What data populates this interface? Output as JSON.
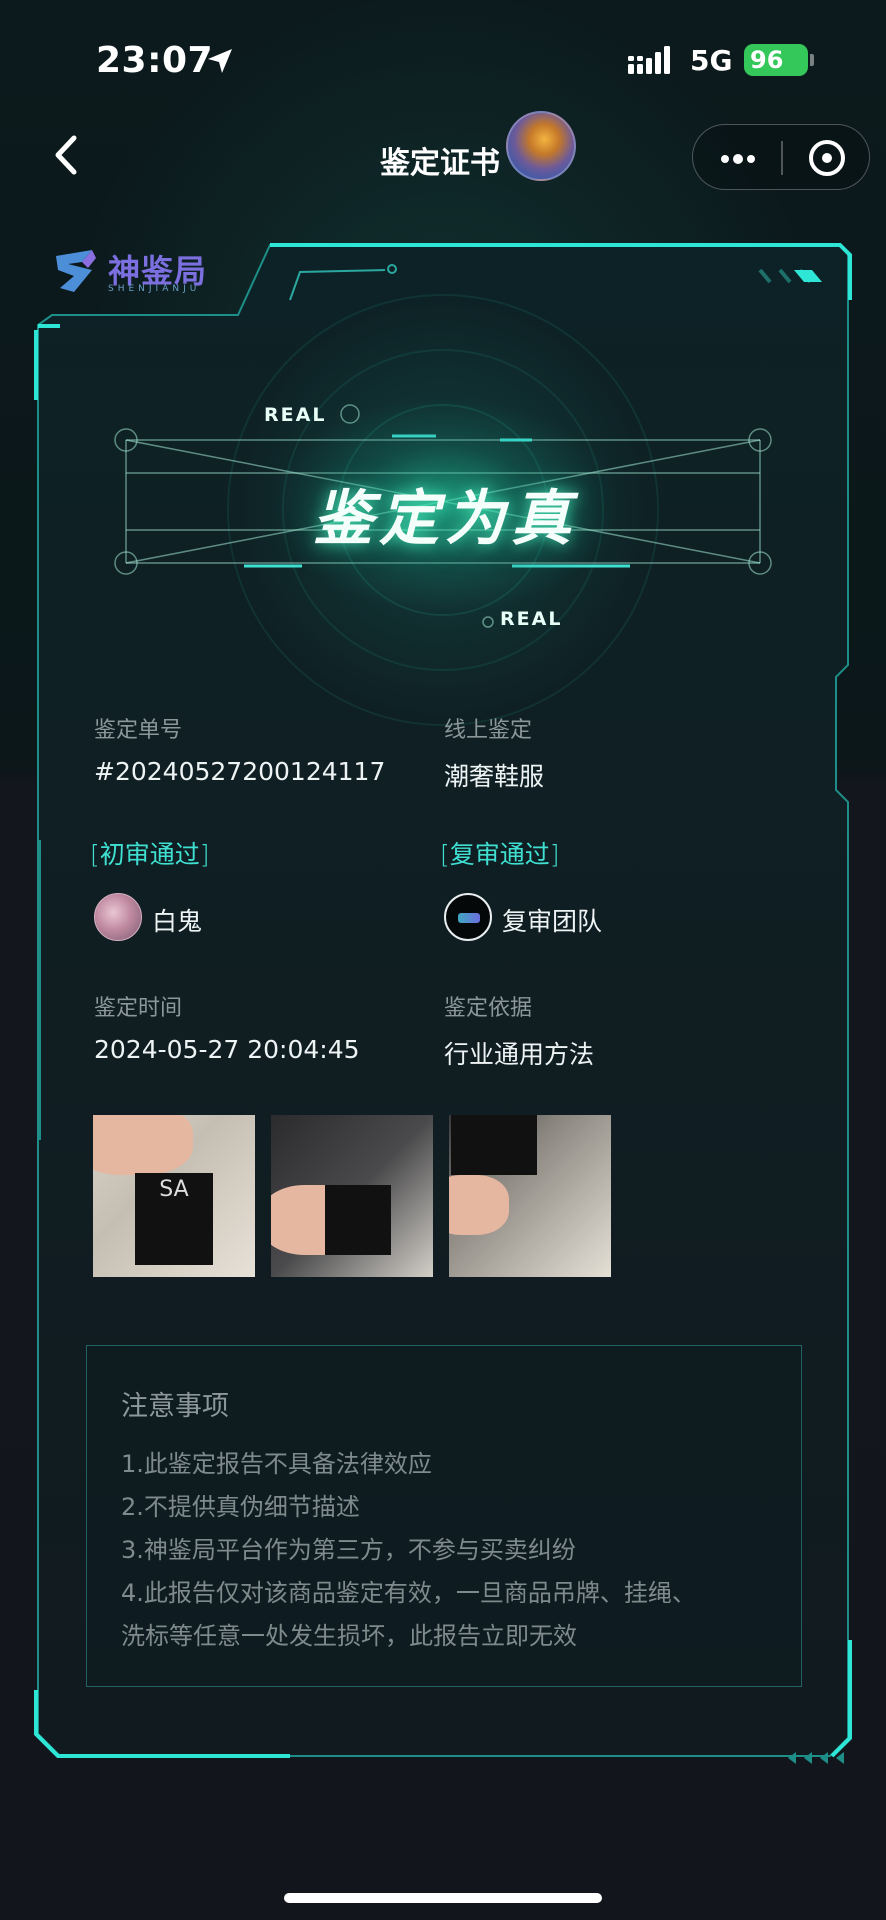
{
  "status_bar": {
    "time": "23:07",
    "network": "5G",
    "battery": "96"
  },
  "nav": {
    "title": "鉴定证书"
  },
  "brand": {
    "name": "神鉴局",
    "sub": "SHENJIANJU"
  },
  "hero": {
    "title": "鉴定为真",
    "tag_top": "REAL",
    "tag_bottom": "REAL"
  },
  "info": {
    "order_label": "鉴定单号",
    "order_value": "#20240527200124117",
    "type_label": "线上鉴定",
    "type_value": "潮奢鞋服",
    "first_review": "初审通过",
    "first_reviewer": "白鬼",
    "second_review": "复审通过",
    "second_reviewer": "复审团队",
    "time_label": "鉴定时间",
    "time_value": "2024-05-27 20:04:45",
    "basis_label": "鉴定依据",
    "basis_value": "行业通用方法"
  },
  "notice": {
    "title": "注意事项",
    "lines": [
      "1.此鉴定报告不具备法律效应",
      "2.不提供真伪细节描述",
      "3.神鉴局平台作为第三方，不参与买卖纠纷",
      "4.此报告仅对该商品鉴定有效，一旦商品吊牌、挂绳、",
      "洗标等任意一处发生损坏，此报告立即无效"
    ]
  },
  "colors": {
    "accent": "#3fe0d2",
    "frame": "#2ee6d6",
    "battery": "#34c759"
  }
}
